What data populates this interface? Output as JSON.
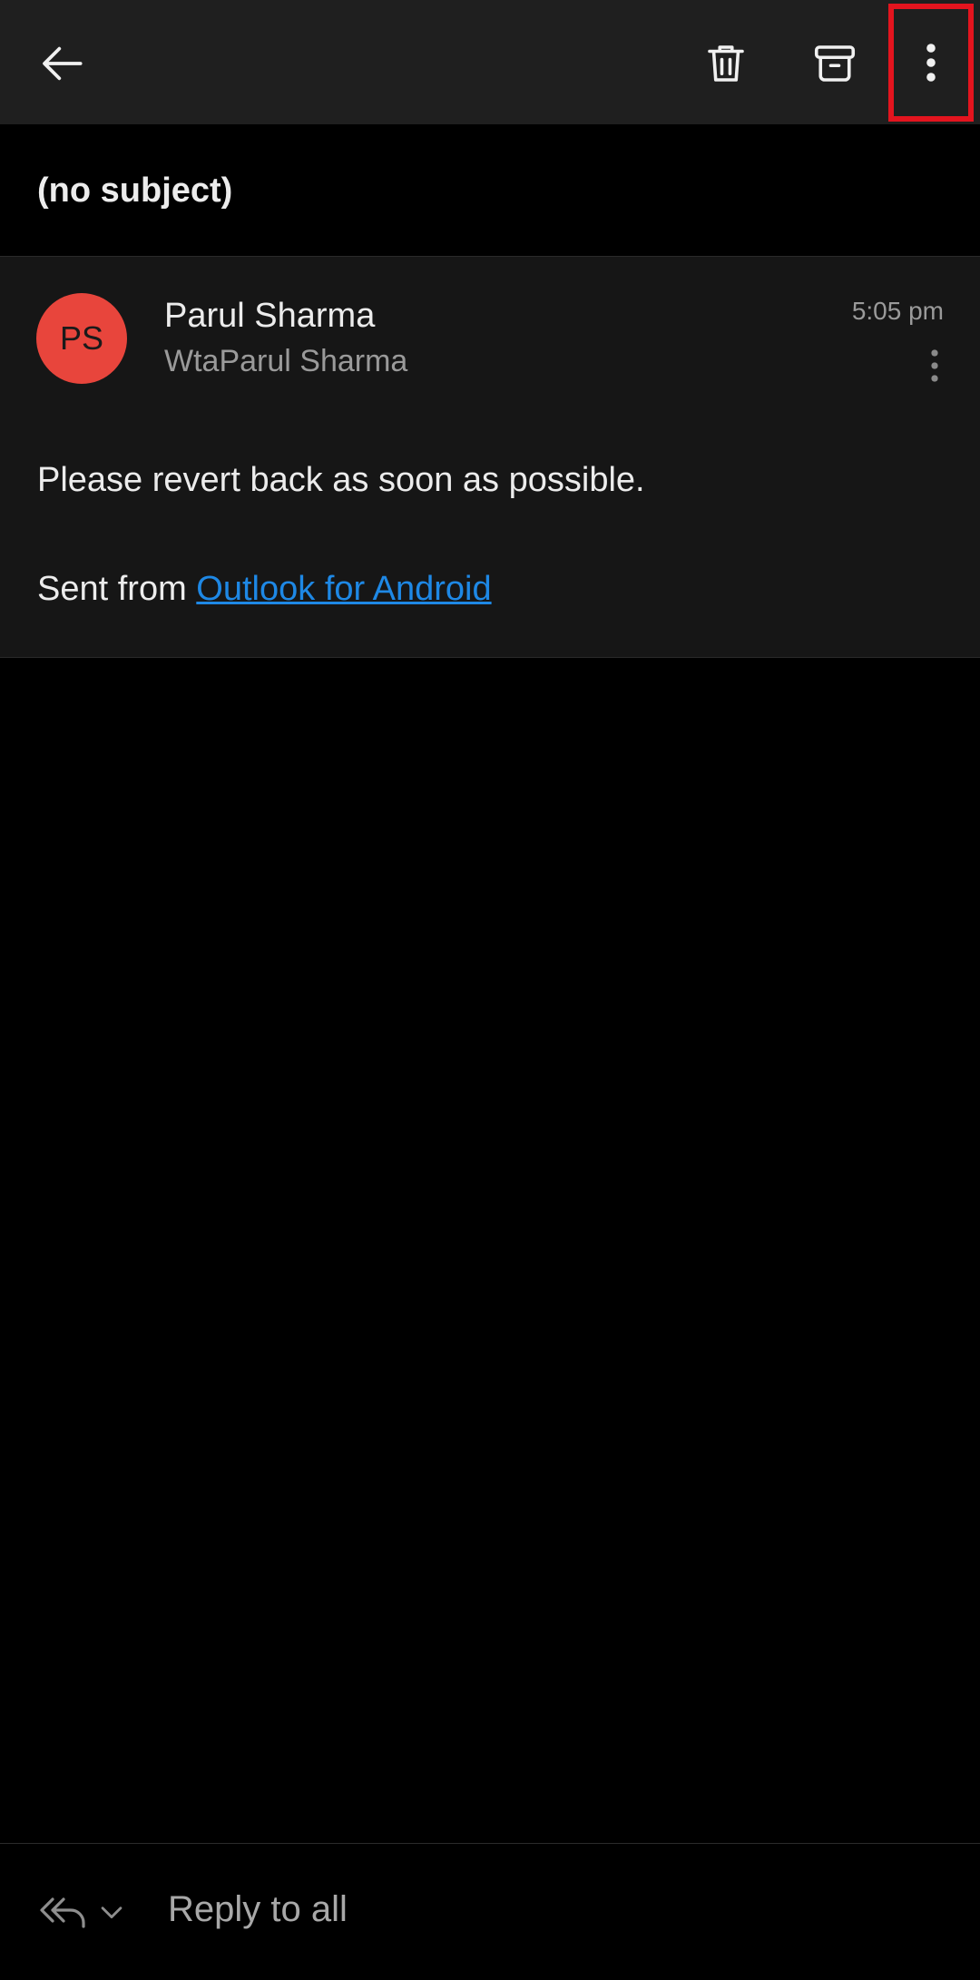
{
  "toolbar": {
    "back_icon": "arrow-left-icon",
    "delete_icon": "trash-icon",
    "archive_icon": "archive-icon",
    "more_icon": "more-vertical-icon",
    "highlight_color": "#e3141e"
  },
  "email": {
    "subject": "(no subject)",
    "avatar_initials": "PS",
    "avatar_color": "#e8453c",
    "sender_name": "Parul Sharma",
    "sender_sub": "WtaParul Sharma",
    "time": "5:05 pm",
    "body_line1": "Please revert back as soon as possible.",
    "signature_prefix": "Sent from",
    "signature_link": "Outlook for Android",
    "link_color": "#1e88e5"
  },
  "reply": {
    "label": "Reply to all",
    "icon": "reply-all-icon",
    "expand_icon": "chevron-down-icon"
  }
}
